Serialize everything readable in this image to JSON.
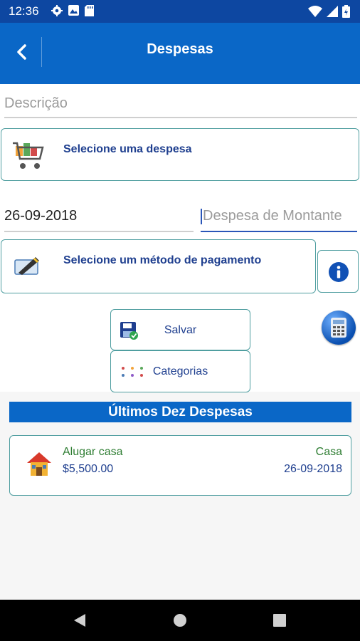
{
  "status": {
    "time": "12:36"
  },
  "appbar": {
    "title": "Despesas"
  },
  "form": {
    "description_placeholder": "Descrição",
    "select_expense": "Selecione uma despesa",
    "date_value": "26-09-2018",
    "amount_placeholder": "Despesa de Montante",
    "select_payment": "Selecione um método de pagamento",
    "save_label": "Salvar",
    "categories_label": "Categorias"
  },
  "recent": {
    "header": "Últimos Dez Despesas",
    "items": [
      {
        "name": "Alugar casa",
        "amount": "$5,500.00",
        "category": "Casa",
        "date": "26-09-2018"
      }
    ]
  },
  "colors": {
    "primary": "#0a67c7",
    "status": "#0d47a1",
    "card_border": "#4f9ea0",
    "text_blue": "#1f3f8f",
    "text_green": "#2e7d32"
  }
}
